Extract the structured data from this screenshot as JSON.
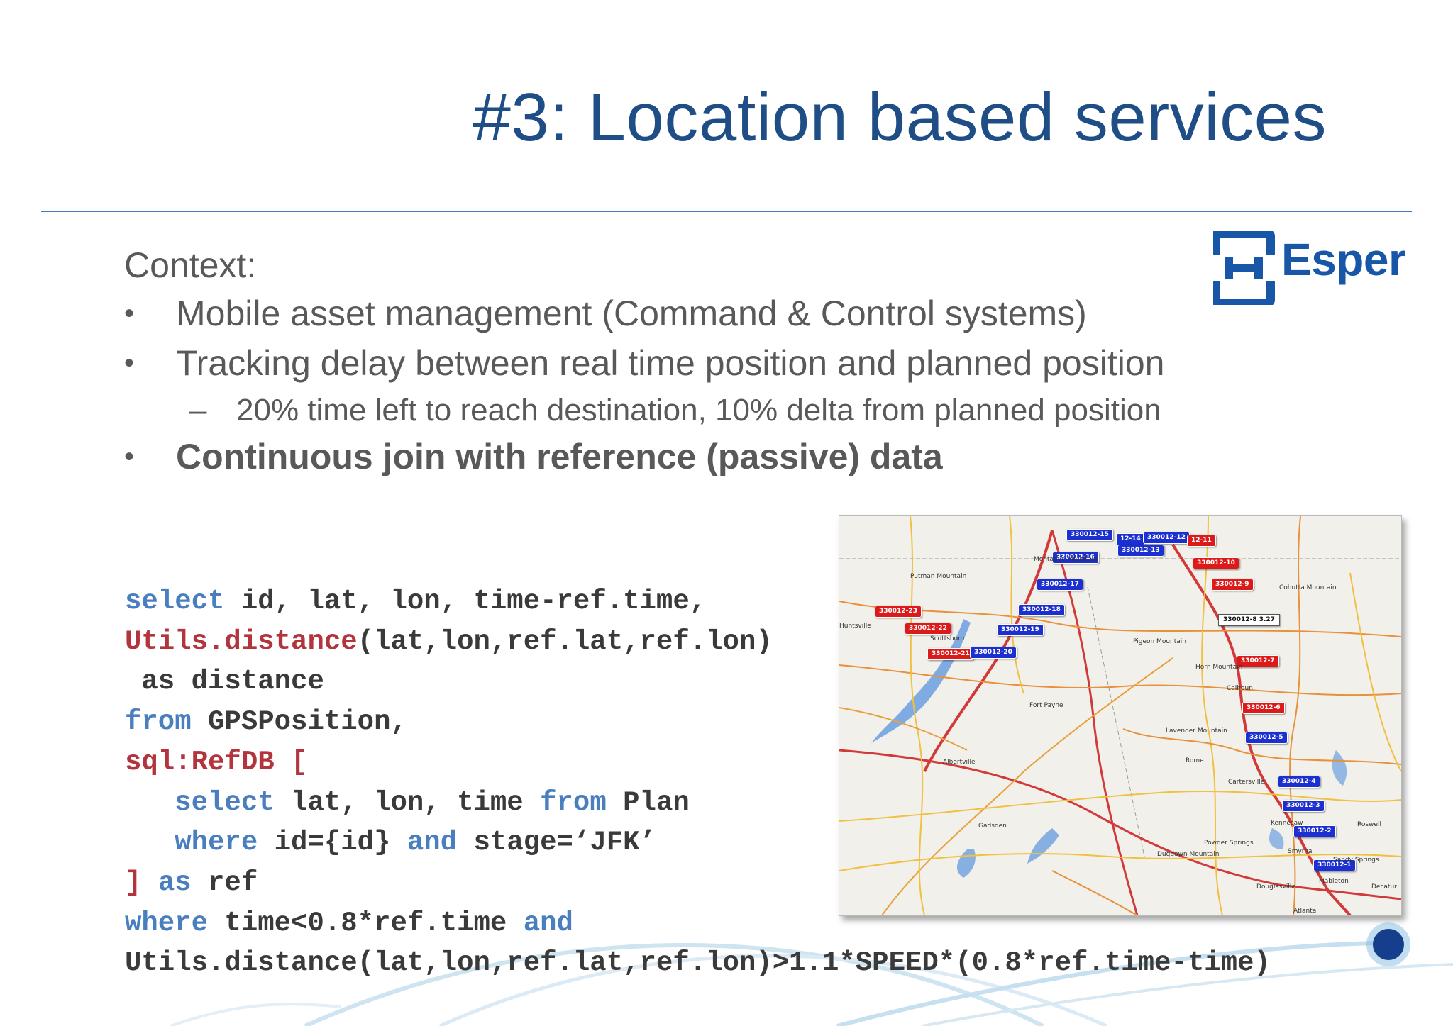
{
  "slide": {
    "title": "#3: Location based services",
    "context_label": "Context:",
    "bullet_glyph": "•",
    "sub_glyph": "–",
    "bullets": [
      "Mobile asset management (Command & Control systems)",
      "Tracking delay between real time position and planned position"
    ],
    "sub_bullet": "20% time left to reach destination, 10% delta from planned position",
    "bold_bullet": "Continuous join with reference (passive) data"
  },
  "logo": {
    "text": "Esper",
    "brand_color": "#1856a8"
  },
  "code": {
    "keyword_color": "#4a7fbf",
    "function_color": "#b2343c",
    "lines": [
      [
        {
          "t": "select",
          "c": "kw"
        },
        {
          "t": " id, lat, lon, time-ref.time,",
          "c": ""
        }
      ],
      [
        {
          "t": "Utils.distance",
          "c": "fn"
        },
        {
          "t": "(lat,lon,ref.lat,ref.lon)",
          "c": ""
        }
      ],
      [
        {
          "t": " as distance",
          "c": ""
        }
      ],
      [
        {
          "t": "from",
          "c": "kw"
        },
        {
          "t": " GPSPosition,",
          "c": ""
        }
      ],
      [
        {
          "t": "sql:RefDB [",
          "c": "fn"
        }
      ],
      [
        {
          "t": "   ",
          "c": ""
        },
        {
          "t": "select",
          "c": "kw"
        },
        {
          "t": " lat, lon, time ",
          "c": ""
        },
        {
          "t": "from",
          "c": "kw"
        },
        {
          "t": " Plan",
          "c": ""
        }
      ],
      [
        {
          "t": "   ",
          "c": ""
        },
        {
          "t": "where",
          "c": "kw"
        },
        {
          "t": " id={id} ",
          "c": ""
        },
        {
          "t": "and",
          "c": "kw"
        },
        {
          "t": " stage=‘JFK’",
          "c": ""
        }
      ],
      [
        {
          "t": "]",
          "c": "fn"
        },
        {
          "t": " ",
          "c": ""
        },
        {
          "t": "as",
          "c": "kw"
        },
        {
          "t": " ref",
          "c": ""
        }
      ],
      [
        {
          "t": "where",
          "c": "kw"
        },
        {
          "t": " time<0.8*ref.time ",
          "c": ""
        },
        {
          "t": "and",
          "c": "kw"
        }
      ],
      [
        {
          "t": "Utils.distance(lat,lon,ref.lat,ref.lon)>1.1*SPEED*(0.8*ref.time-time)",
          "c": ""
        }
      ]
    ]
  },
  "map": {
    "callout": "330012-8 3.27",
    "markers": [
      {
        "label": "330012-15",
        "color": "blue"
      },
      {
        "label": "12-14",
        "color": "blue"
      },
      {
        "label": "330012-12",
        "color": "blue"
      },
      {
        "label": "12-11",
        "color": "red"
      },
      {
        "label": "330012-16",
        "color": "blue"
      },
      {
        "label": "330012-13",
        "color": "blue"
      },
      {
        "label": "330012-10",
        "color": "red"
      },
      {
        "label": "330012-17",
        "color": "blue"
      },
      {
        "label": "330012-9",
        "color": "red"
      },
      {
        "label": "330012-23",
        "color": "red"
      },
      {
        "label": "330012-18",
        "color": "blue"
      },
      {
        "label": "330012-22",
        "color": "red"
      },
      {
        "label": "330012-19",
        "color": "blue"
      },
      {
        "label": "330012-21",
        "color": "red"
      },
      {
        "label": "330012-20",
        "color": "blue"
      },
      {
        "label": "330012-7",
        "color": "red"
      },
      {
        "label": "330012-6",
        "color": "red"
      },
      {
        "label": "330012-5",
        "color": "blue"
      },
      {
        "label": "330012-4",
        "color": "blue"
      },
      {
        "label": "330012-3",
        "color": "blue"
      },
      {
        "label": "330012-2",
        "color": "blue"
      },
      {
        "label": "330012-1",
        "color": "blue"
      }
    ],
    "places": [
      "Huntsville",
      "Scottsboro",
      "Fort Payne",
      "Albertville",
      "Gadsden",
      "Rome",
      "Calhoun",
      "Cartersville",
      "Kennesaw",
      "Smyrna",
      "Douglasville",
      "Atlanta",
      "Dugdown Mountain",
      "Lavender Mountain",
      "Pigeon Mountain",
      "Horn Mountain",
      "Cohutta Mountain",
      "Putman Mountain",
      "Montague Mountain",
      "Powder Springs",
      "Mableton",
      "Sandy Springs",
      "Roswell",
      "Decatur"
    ]
  }
}
